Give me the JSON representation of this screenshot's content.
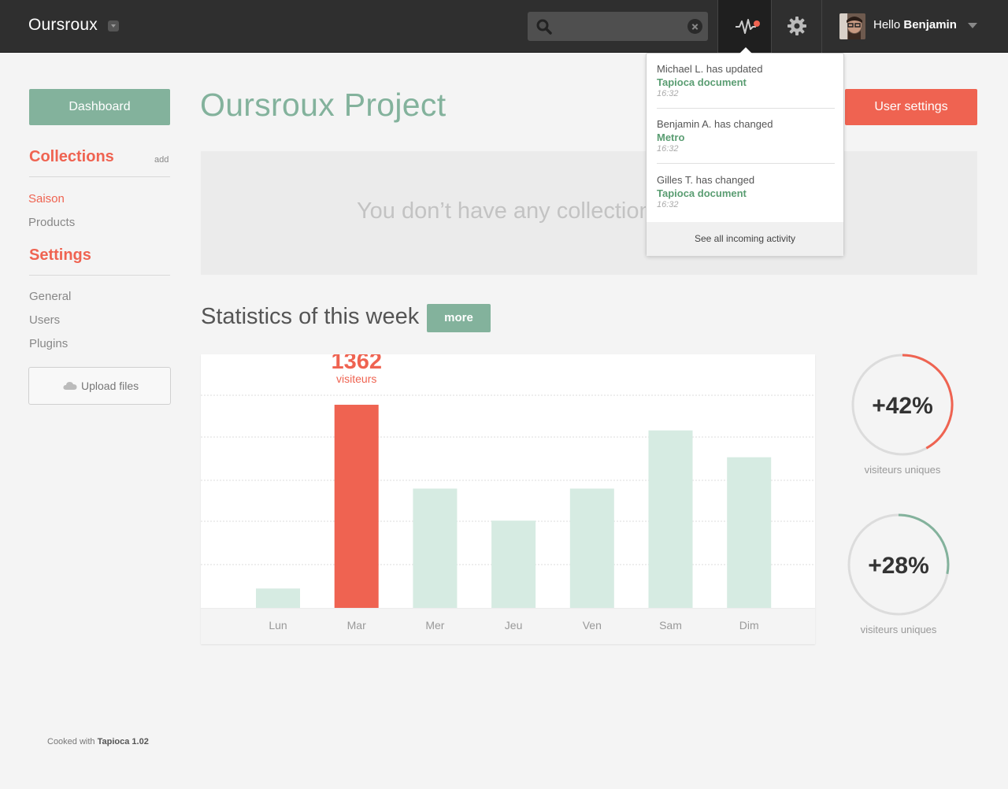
{
  "topbar": {
    "brand": "Oursroux",
    "search_placeholder": "",
    "greeting": "Hello",
    "user_name": "Benjamin"
  },
  "sidebar": {
    "dashboard_label": "Dashboard",
    "collections_heading": "Collections",
    "collections_add": "add",
    "collections": [
      {
        "label": "Saison",
        "active": true
      },
      {
        "label": "Products",
        "active": false
      }
    ],
    "settings_heading": "Settings",
    "settings": [
      {
        "label": "General"
      },
      {
        "label": "Users"
      },
      {
        "label": "Plugins"
      }
    ],
    "upload_label": "Upload files"
  },
  "main": {
    "title": "Oursroux Project",
    "user_settings_label": "User settings",
    "empty_message": "You don’t have any collection",
    "stats_title": "Statistics of this week",
    "more_label": "more"
  },
  "chart_data": {
    "type": "bar",
    "categories": [
      "Lun",
      "Mar",
      "Mer",
      "Jeu",
      "Ven",
      "Sam",
      "Dim"
    ],
    "values": [
      130,
      1362,
      800,
      585,
      800,
      1190,
      1010
    ],
    "highlight_index": 1,
    "highlight_value_label": "1362",
    "highlight_unit_label": "visiteurs",
    "ylim": [
      0,
      1700
    ],
    "grid": true,
    "colors": {
      "highlight": "#ef6351",
      "default": "#d6ebe2"
    }
  },
  "rings": [
    {
      "value_label": "+42%",
      "caption": "visiteurs uniques",
      "fraction": 0.42,
      "color": "#ef6351"
    },
    {
      "value_label": "+28%",
      "caption": "visiteurs uniques",
      "fraction": 0.28,
      "color": "#83b29c"
    }
  ],
  "activity": {
    "items": [
      {
        "line1": "Michael L. has updated",
        "target": "Tapioca document",
        "time": "16:32"
      },
      {
        "line1": "Benjamin A. has changed",
        "target": "Metro",
        "time": "16:32"
      },
      {
        "line1": "Gilles T. has changed",
        "target": "Tapioca document",
        "time": "16:32"
      }
    ],
    "footer_label": "See all incoming activity"
  },
  "footer": {
    "prefix": "Cooked with",
    "product": "Tapioca 1.02"
  },
  "colors": {
    "accent_green": "#83b29c",
    "accent_red": "#ef6351",
    "topbar": "#2f2f2f"
  }
}
